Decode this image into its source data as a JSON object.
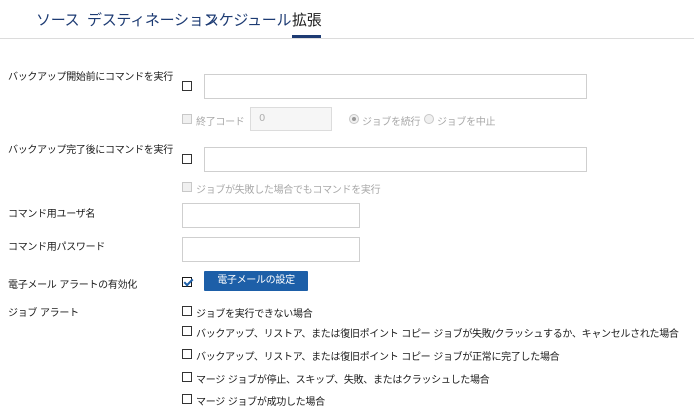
{
  "tabs": [
    "ソース",
    "デスティネーション",
    "スケジュール",
    "拡張"
  ],
  "pre_command": {
    "label": "バックアップ開始前にコマンドを実行",
    "exit_code_label": "終了コード",
    "exit_code_value": "0",
    "continue_label": "ジョブを続行",
    "abort_label": "ジョブを中止"
  },
  "post_command": {
    "label": "バックアップ完了後にコマンドを実行",
    "run_on_fail_label": "ジョブが失敗した場合でもコマンドを実行"
  },
  "command_user_label": "コマンド用ユーザ名",
  "command_password_label": "コマンド用パスワード",
  "email": {
    "label": "電子メール アラートの有効化",
    "settings_button": "電子メールの設定"
  },
  "job_alerts": {
    "label": "ジョブ アラート",
    "items": [
      "ジョブを実行できない場合",
      "バックアップ、リストア、または復旧ポイント コピー ジョブが失敗/クラッシュするか、キャンセルされた場合",
      "バックアップ、リストア、または復旧ポイント コピー ジョブが正常に完了した場合",
      "マージ ジョブが停止、スキップ、失敗、またはクラッシュした場合",
      "マージ ジョブが成功した場合"
    ]
  }
}
